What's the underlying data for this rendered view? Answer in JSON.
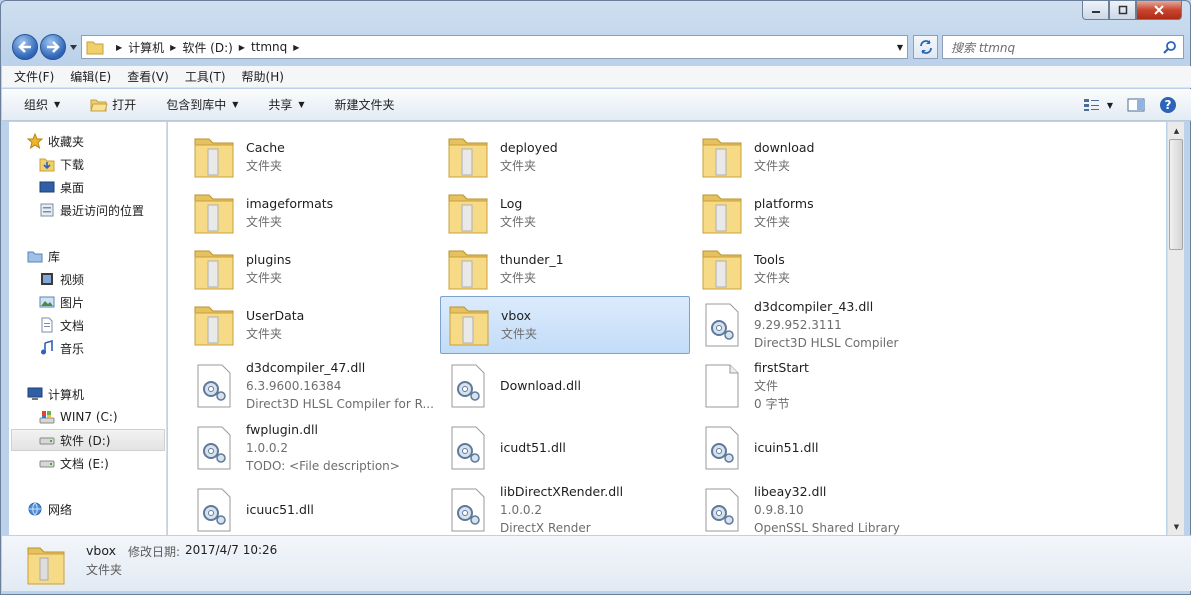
{
  "window": {
    "caption_buttons": [
      "minimize",
      "maximize",
      "close"
    ]
  },
  "address": {
    "crumbs": [
      "计算机",
      "软件 (D:)",
      "ttmnq"
    ],
    "search_placeholder": "搜索 ttmnq"
  },
  "menu": [
    "文件(F)",
    "编辑(E)",
    "查看(V)",
    "工具(T)",
    "帮助(H)"
  ],
  "toolbar": {
    "organize": "组织",
    "open": "打开",
    "include_library": "包含到库中",
    "share": "共享",
    "new_folder": "新建文件夹"
  },
  "navpane": {
    "favorites": "收藏夹",
    "downloads": "下载",
    "desktop": "桌面",
    "recent": "最近访问的位置",
    "libraries": "库",
    "videos": "视频",
    "pictures": "图片",
    "documents": "文档",
    "music": "音乐",
    "computer": "计算机",
    "drive_c": "WIN7 (C:)",
    "drive_d": "软件 (D:)",
    "drive_e": "文档 (E:)",
    "network": "网络"
  },
  "items": [
    {
      "name": "Cache",
      "l1": "文件夹",
      "l2": "",
      "kind": "folder"
    },
    {
      "name": "deployed",
      "l1": "文件夹",
      "l2": "",
      "kind": "folder"
    },
    {
      "name": "download",
      "l1": "文件夹",
      "l2": "",
      "kind": "folder"
    },
    {
      "name": "imageformats",
      "l1": "文件夹",
      "l2": "",
      "kind": "folder"
    },
    {
      "name": "Log",
      "l1": "文件夹",
      "l2": "",
      "kind": "folder"
    },
    {
      "name": "platforms",
      "l1": "文件夹",
      "l2": "",
      "kind": "folder"
    },
    {
      "name": "plugins",
      "l1": "文件夹",
      "l2": "",
      "kind": "folder"
    },
    {
      "name": "thunder_1",
      "l1": "文件夹",
      "l2": "",
      "kind": "folder"
    },
    {
      "name": "Tools",
      "l1": "文件夹",
      "l2": "",
      "kind": "folder"
    },
    {
      "name": "UserData",
      "l1": "文件夹",
      "l2": "",
      "kind": "folder"
    },
    {
      "name": "vbox",
      "l1": "文件夹",
      "l2": "",
      "kind": "folder",
      "selected": true
    },
    {
      "name": "d3dcompiler_43.dll",
      "l1": "9.29.952.3111",
      "l2": "Direct3D HLSL Compiler",
      "kind": "dll"
    },
    {
      "name": "d3dcompiler_47.dll",
      "l1": "6.3.9600.16384",
      "l2": "Direct3D HLSL Compiler for R...",
      "kind": "dll"
    },
    {
      "name": "Download.dll",
      "l1": "",
      "l2": "",
      "kind": "dll"
    },
    {
      "name": "firstStart",
      "l1": "文件",
      "l2": "0 字节",
      "kind": "file"
    },
    {
      "name": "fwplugin.dll",
      "l1": "1.0.0.2",
      "l2": "TODO: <File description>",
      "kind": "dll"
    },
    {
      "name": "icudt51.dll",
      "l1": "",
      "l2": "",
      "kind": "dll"
    },
    {
      "name": "icuin51.dll",
      "l1": "",
      "l2": "",
      "kind": "dll"
    },
    {
      "name": "icuuc51.dll",
      "l1": "",
      "l2": "",
      "kind": "dll"
    },
    {
      "name": "libDirectXRender.dll",
      "l1": "1.0.0.2",
      "l2": "DirectX Render",
      "kind": "dll"
    },
    {
      "name": "libeay32.dll",
      "l1": "0.9.8.10",
      "l2": "OpenSSL Shared Library",
      "kind": "dll"
    }
  ],
  "details": {
    "name": "vbox",
    "date_label": "修改日期:",
    "date_value": "2017/4/7 10:26",
    "type": "文件夹"
  },
  "colors": {
    "selection": "#c2dcf8",
    "folder": "#f3d57a",
    "accent": "#2d64b8"
  }
}
